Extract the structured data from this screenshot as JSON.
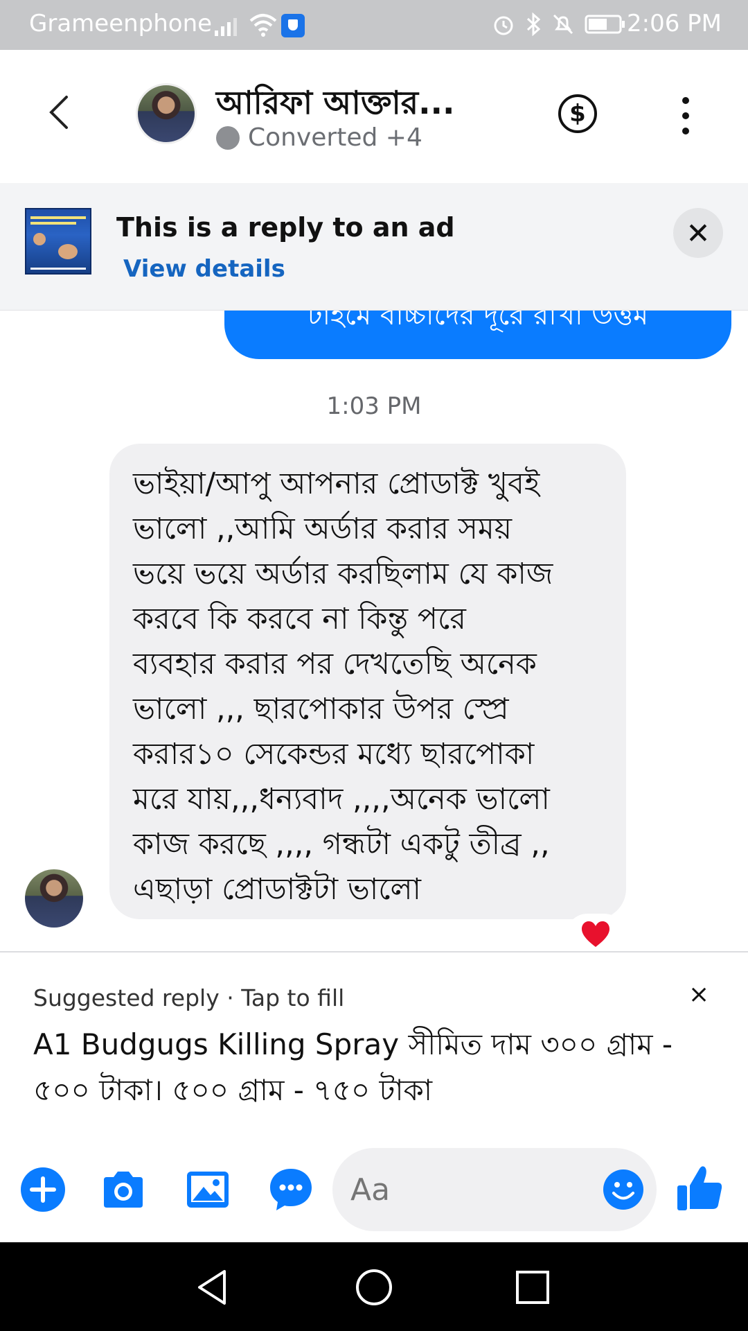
{
  "status_bar": {
    "carrier": "Grameenphone",
    "time": "2:06 PM"
  },
  "header": {
    "contact_name": "আরিফা আক্তার...",
    "status_text": "Converted +4",
    "icons": [
      "back-icon",
      "dollar-icon",
      "more-vertical-icon"
    ]
  },
  "ad_banner": {
    "title": "This is a reply to an ad",
    "link": "View details",
    "close_icon": "close-icon"
  },
  "chat": {
    "sent_partial": "টাইমে বাচ্চাদের দূরে রাখা উত্তম",
    "timestamp": "1:03 PM",
    "received_lines": [
      "ভাইয়া/আপু আপনার প্রোডাক্ট খুবই",
      "ভালো ,,আমি অর্ডার করার সময়",
      "ভয়ে ভয়ে অর্ডার করছিলাম যে কাজ",
      "করবে কি করবে না কিন্তু পরে",
      "ব্যবহার করার পর দেখতেছি অনেক",
      "ভালো ,,, ছারপোকার উপর স্প্রে",
      "করার১০ সেকেন্ডর মধ্যে ছারপোকা",
      "মরে যায়,,,ধন্যবাদ ,,,,অনেক ভালো",
      "কাজ করছে ,,,, গন্ধটা  একটু তীব্র ,,",
      "এছাড়া প্রোডাক্টটা ভালো"
    ],
    "reaction": "heart-icon"
  },
  "suggested_reply": {
    "header": "Suggested reply · Tap to fill",
    "close": "×",
    "text": "A1 Budgugs Killing Spray সীমিত দাম ৩০০ গ্রাম - ৫০০ টাকা। ৫০০ গ্রাম - ৭৫০ টাকা"
  },
  "composer": {
    "placeholder": "Aa",
    "icons": [
      "plus-icon",
      "camera-icon",
      "gallery-icon",
      "chat-bubble-icon",
      "emoji-icon",
      "like-icon"
    ]
  },
  "colors": {
    "accent": "#0a7cff",
    "status_bar": "#c6c7c9",
    "bubble_received": "#f0f0f2",
    "link": "#1565c0"
  }
}
